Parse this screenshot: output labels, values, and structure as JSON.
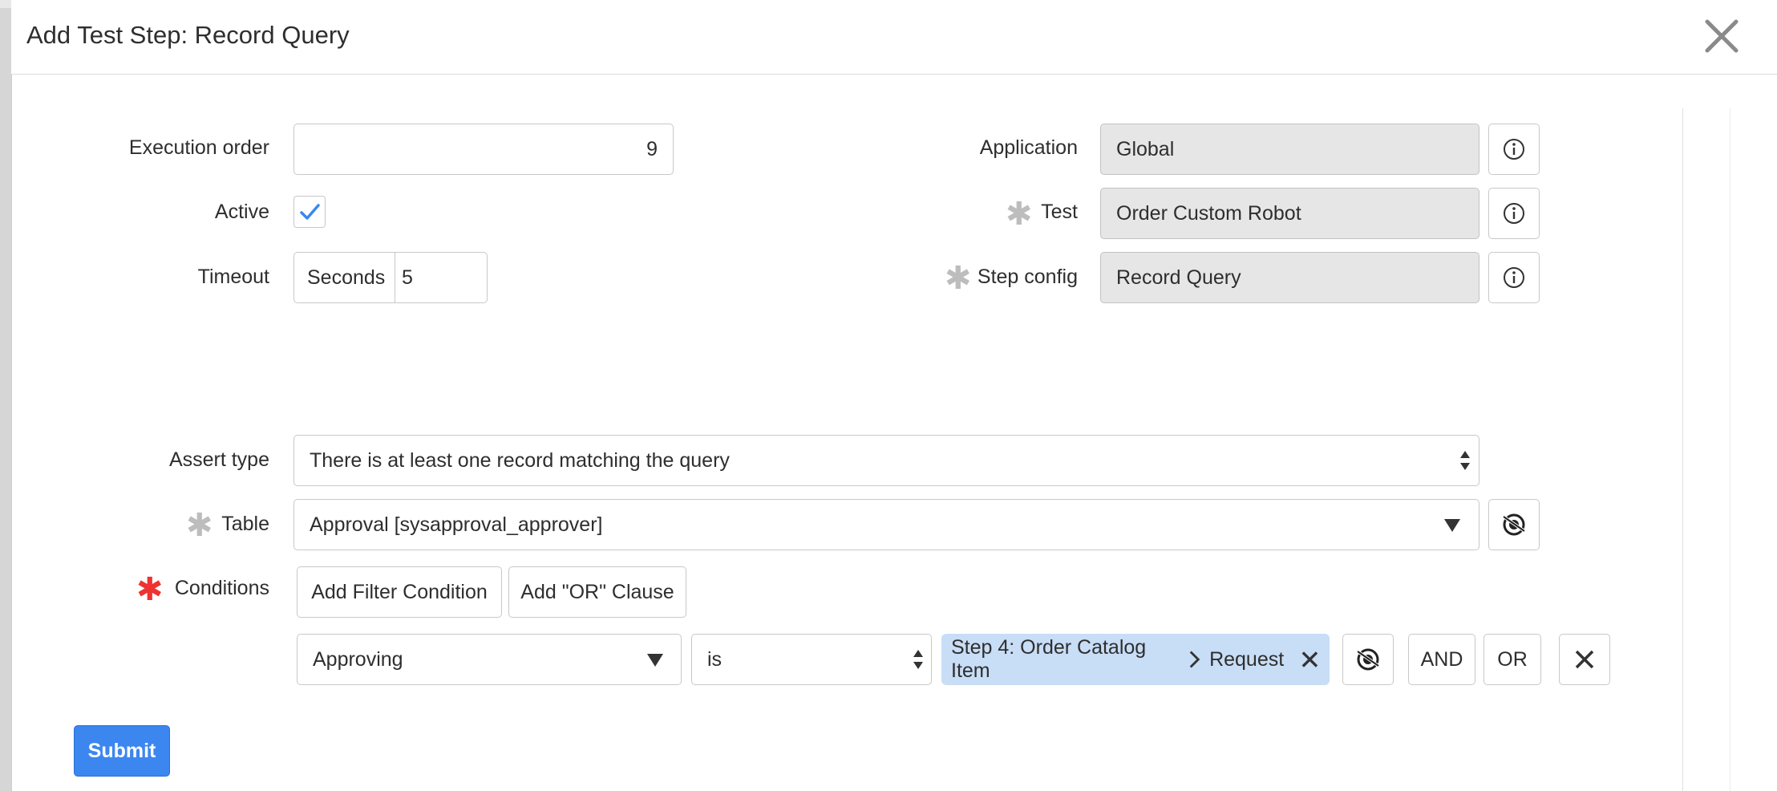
{
  "dialog": {
    "title": "Add Test Step: Record Query"
  },
  "form": {
    "execution_order_label": "Execution order",
    "execution_order_value": "9",
    "active_label": "Active",
    "active_checked": true,
    "timeout_label": "Timeout",
    "timeout_unit": "Seconds",
    "timeout_value": "5",
    "application_label": "Application",
    "application_value": "Global",
    "test_label": "Test",
    "test_value": "Order Custom Robot",
    "step_config_label": "Step config",
    "step_config_value": "Record Query",
    "assert_type_label": "Assert type",
    "assert_type_value": "There is at least one record matching the query",
    "table_label": "Table",
    "table_value": "Approval [sysapproval_approver]",
    "conditions_label": "Conditions"
  },
  "conditions": {
    "add_filter_label": "Add Filter Condition",
    "add_or_clause_label": "Add \"OR\" Clause",
    "field_value": "Approving",
    "operator_value": "is",
    "chip_part1": "Step 4: Order Catalog Item",
    "chip_part2": "Request",
    "and_label": "AND",
    "or_label": "OR"
  },
  "actions": {
    "submit_label": "Submit"
  },
  "colors": {
    "accent": "#3c86f0",
    "required": "#e33333",
    "chip_bg": "#c8ddf6"
  },
  "icons": [
    "close-icon",
    "info-icon",
    "checkmark-icon",
    "dropdown-arrow-icon",
    "select-arrows-icon",
    "reference-picker-icon",
    "chevron-right-icon",
    "remove-icon",
    "asterisk-icon"
  ]
}
